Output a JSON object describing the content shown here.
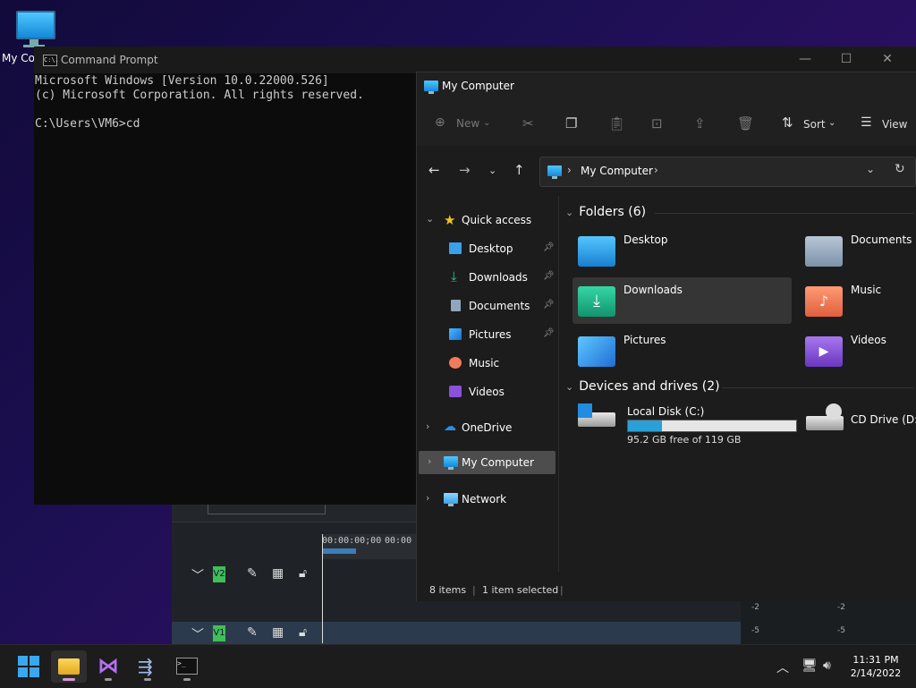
{
  "desktop": {
    "icon_label": "My Computer"
  },
  "editor": {
    "timecodes": [
      "00:00:00;00",
      "00:00"
    ],
    "tracks": [
      {
        "label": "V2"
      },
      {
        "label": "V1"
      }
    ],
    "meter_ticks": [
      "-2",
      "-2",
      "-5",
      "-5"
    ]
  },
  "cmd": {
    "title": "Command Prompt",
    "icon_text": "C:\\.",
    "lines": [
      "Microsoft Windows [Version 10.0.22000.526]",
      "(c) Microsoft Corporation. All rights reserved.",
      "",
      "C:\\Users\\VM6>cd"
    ],
    "buttons": {
      "minimize": "—",
      "maximize": "☐",
      "close": "✕"
    }
  },
  "explorer": {
    "title": "My Computer",
    "commands": {
      "new": "New",
      "sort": "Sort",
      "view": "View"
    },
    "address": {
      "path": "My Computer"
    },
    "sidebar": [
      {
        "label": "Quick access",
        "level": 0,
        "expanded": true
      },
      {
        "label": "Desktop",
        "level": 1,
        "pinned": true
      },
      {
        "label": "Downloads",
        "level": 1,
        "pinned": true
      },
      {
        "label": "Documents",
        "level": 1,
        "pinned": true
      },
      {
        "label": "Pictures",
        "level": 1,
        "pinned": true
      },
      {
        "label": "Music",
        "level": 1
      },
      {
        "label": "Videos",
        "level": 1
      },
      {
        "label": "OneDrive",
        "level": 0
      },
      {
        "label": "My Computer",
        "level": 0,
        "selected": true
      },
      {
        "label": "Network",
        "level": 0
      }
    ],
    "folders_header": "Folders (6)",
    "folders": [
      "Desktop",
      "Documents",
      "Downloads",
      "Music",
      "Pictures",
      "Videos"
    ],
    "drives_header": "Devices and drives (2)",
    "drives": [
      {
        "name": "Local Disk (C:)",
        "free_text": "95.2 GB free of 119 GB",
        "used_fraction": 0.2
      },
      {
        "name": "CD Drive (D:)"
      }
    ],
    "status": {
      "items": "8 items",
      "selected": "1 item selected"
    }
  },
  "taskbar": {
    "time": "11:31 PM",
    "date": "2/14/2022"
  },
  "colors": {
    "accent": "#2a9fd8",
    "folder_blue": "#1e90d6",
    "downloads_green": "#1fb58a",
    "music_orange": "#f07b5a",
    "videos_purple": "#8a52d8"
  }
}
